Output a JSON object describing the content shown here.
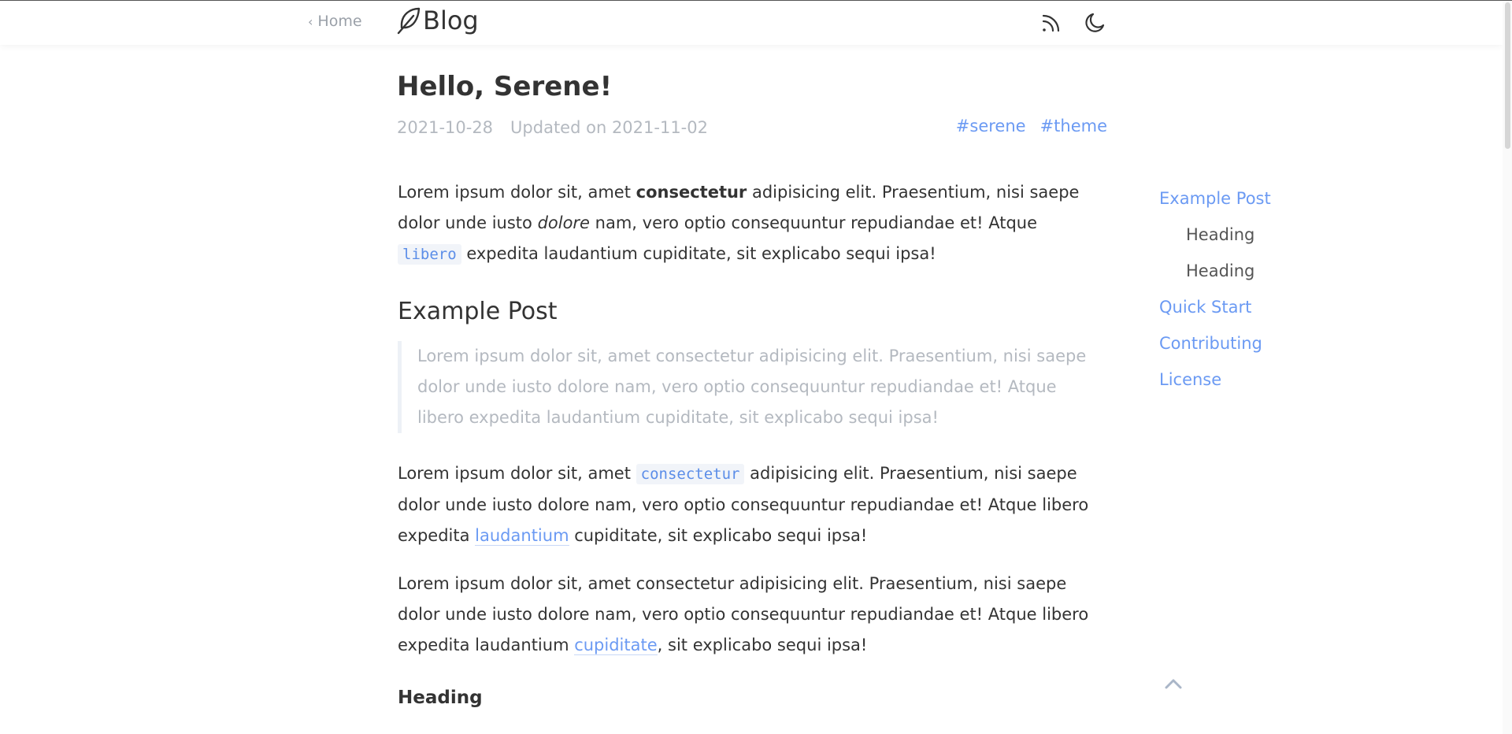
{
  "header": {
    "home_label": "Home",
    "brand": "Blog",
    "rss_icon": "rss-icon",
    "theme_icon": "moon-icon"
  },
  "post": {
    "title": "Hello, Serene!",
    "date": "2021-10-28",
    "updated": "Updated on 2021-11-02",
    "tags": [
      "#serene",
      "#theme"
    ]
  },
  "content": {
    "p1": {
      "a": "Lorem ipsum dolor sit, amet ",
      "bold": "consectetur",
      "b": " adipisicing elit. Praesentium, nisi saepe dolor unde iusto ",
      "italic": "dolore",
      "c": " nam, vero optio consequuntur repudiandae et! Atque ",
      "code": "libero",
      "d": " expedita laudantium cupiditate, sit explicabo sequi ipsa!"
    },
    "h2": "Example Post",
    "quote": "Lorem ipsum dolor sit, amet consectetur adipisicing elit. Praesentium, nisi saepe dolor unde iusto dolore nam, vero optio consequuntur repudiandae et! Atque libero expedita laudantium cupiditate, sit explicabo sequi ipsa!",
    "p2": {
      "a": "Lorem ipsum dolor sit, amet ",
      "code": "consectetur",
      "b": " adipisicing elit. Praesentium, nisi saepe dolor unde iusto dolore nam, vero optio consequuntur repudiandae et! Atque libero expedita ",
      "link": "laudantium",
      "c": " cupiditate, sit explicabo sequi ipsa!"
    },
    "p3": {
      "a": "Lorem ipsum dolor sit, amet consectetur adipisicing elit. Praesentium, nisi saepe dolor unde iusto dolore nam, vero optio consequuntur repudiandae et! Atque libero expedita laudantium ",
      "link": "cupiditate",
      "b": ", sit explicabo sequi ipsa!"
    },
    "h3": "Heading"
  },
  "toc": [
    {
      "label": "Example Post",
      "level": 1
    },
    {
      "label": "Heading",
      "level": 2
    },
    {
      "label": "Heading",
      "level": 2
    },
    {
      "label": "Quick Start",
      "level": 1
    },
    {
      "label": "Contributing",
      "level": 1
    },
    {
      "label": "License",
      "level": 1
    }
  ],
  "back_to_top_icon": "chevron-up-icon",
  "colors": {
    "accent": "#6b9af3",
    "text": "#333333",
    "muted": "#b4b9c0",
    "code_bg": "#f1f4f9"
  }
}
